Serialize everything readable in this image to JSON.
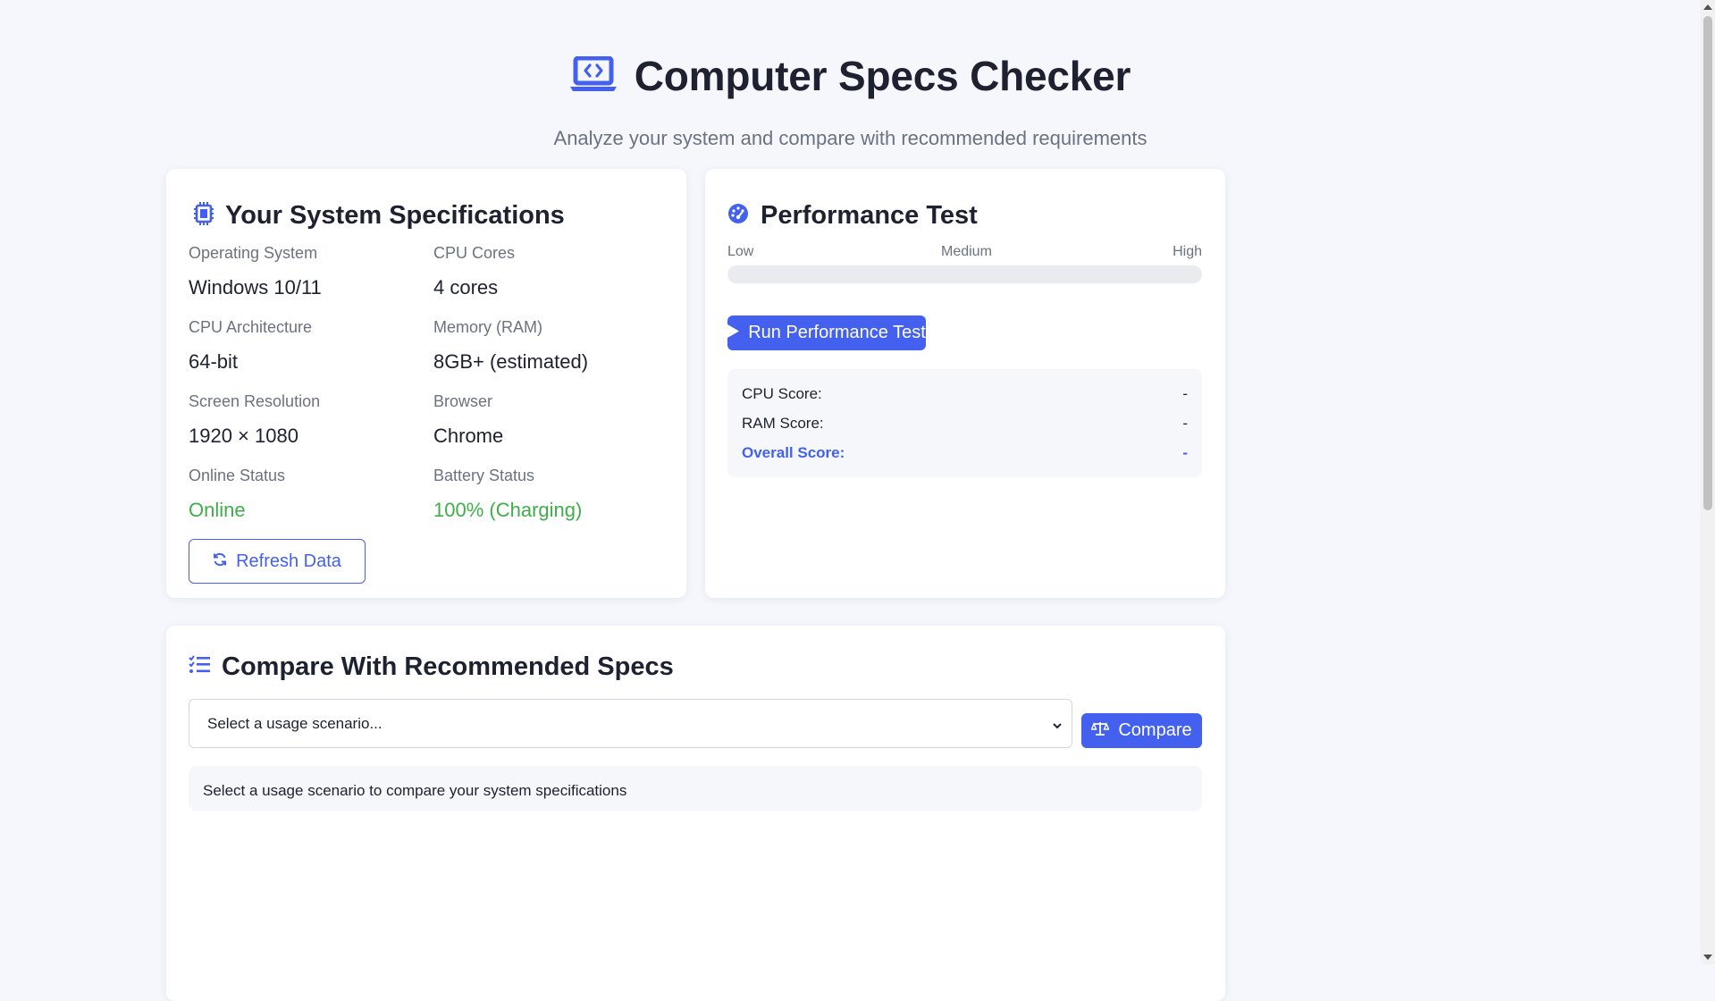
{
  "header": {
    "title": "Computer Specs Checker",
    "subtitle": "Analyze your system and compare with recommended requirements",
    "icon": "laptop-code-icon"
  },
  "system_specs": {
    "title": "Your System Specifications",
    "icon": "microchip-icon",
    "items": [
      {
        "label": "Operating System",
        "value": "Windows 10/11"
      },
      {
        "label": "CPU Cores",
        "value": "4 cores"
      },
      {
        "label": "CPU Architecture",
        "value": "64-bit"
      },
      {
        "label": "Memory (RAM)",
        "value": "8GB+ (estimated)"
      },
      {
        "label": "Screen Resolution",
        "value": "1920 × 1080"
      },
      {
        "label": "Browser",
        "value": "Chrome"
      },
      {
        "label": "Online Status",
        "value": "Online"
      },
      {
        "label": "Battery Status",
        "value": "100% (Charging)"
      }
    ],
    "refresh_label": "Refresh Data",
    "status_color": "#3fae4a"
  },
  "performance": {
    "title": "Performance Test",
    "icon": "gauge-icon",
    "scale": {
      "low": "Low",
      "medium": "Medium",
      "high": "High"
    },
    "progress_percent": 0,
    "run_label": "Run Performance Test",
    "scores": {
      "cpu_label": "CPU Score:",
      "cpu_value": "-",
      "ram_label": "RAM Score:",
      "ram_value": "-",
      "overall_label": "Overall Score:",
      "overall_value": "-"
    }
  },
  "compare": {
    "title": "Compare With Recommended Specs",
    "icon": "list-check-icon",
    "select_placeholder": "Select a usage scenario...",
    "compare_label": "Compare",
    "hint": "Select a usage scenario to compare your system specifications"
  },
  "colors": {
    "accent": "#4361ee",
    "background": "#f5f7fc",
    "success": "#3fae4a"
  }
}
